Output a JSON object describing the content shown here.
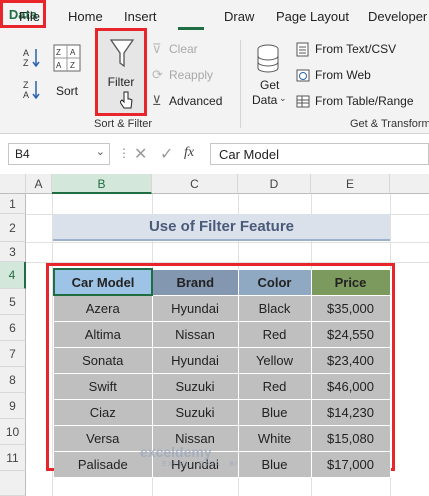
{
  "menu": {
    "tabs": [
      "File",
      "Home",
      "Insert",
      "Data",
      "Draw",
      "Page Layout",
      "Developer"
    ],
    "active_tab": "Data"
  },
  "ribbon": {
    "sort_label": "Sort",
    "filter_label": "Filter",
    "clear_label": "Clear",
    "reapply_label": "Reapply",
    "advanced_label": "Advanced",
    "sort_filter_group": "Sort & Filter",
    "get_data_label_1": "Get",
    "get_data_label_2": "Data",
    "from_text_csv": "From Text/CSV",
    "from_web": "From Web",
    "from_table_range": "From Table/Range",
    "get_transform_group": "Get & Transform"
  },
  "formula_bar": {
    "name_box": "B4",
    "formula": "Car Model"
  },
  "grid": {
    "columns": [
      "A",
      "B",
      "C",
      "D",
      "E"
    ],
    "rows": [
      "1",
      "2",
      "3",
      "4",
      "5",
      "6",
      "7",
      "8",
      "9",
      "10",
      "11"
    ],
    "active_column": "B",
    "active_row": "4"
  },
  "sheet": {
    "title": "Use of Filter Feature",
    "headers": [
      "Car Model",
      "Brand",
      "Color",
      "Price"
    ],
    "header_colors": [
      "#9dc3e6",
      "#8497b0",
      "#8ea9c1",
      "#7d9a5e"
    ],
    "rows": [
      [
        "Azera",
        "Hyundai",
        "Black",
        "$35,000"
      ],
      [
        "Altima",
        "Nissan",
        "Red",
        "$24,550"
      ],
      [
        "Sonata",
        "Hyundai",
        "Yellow",
        "$23,400"
      ],
      [
        "Swift",
        "Suzuki",
        "Red",
        "$46,000"
      ],
      [
        "Ciaz",
        "Suzuki",
        "Blue",
        "$14,230"
      ],
      [
        "Versa",
        "Nissan",
        "White",
        "$15,080"
      ],
      [
        "Palisade",
        "Hyundai",
        "Blue",
        "$17,000"
      ]
    ]
  },
  "watermark": {
    "name": "exceldemy",
    "tagline": "EXCEL · DATA · BI"
  }
}
